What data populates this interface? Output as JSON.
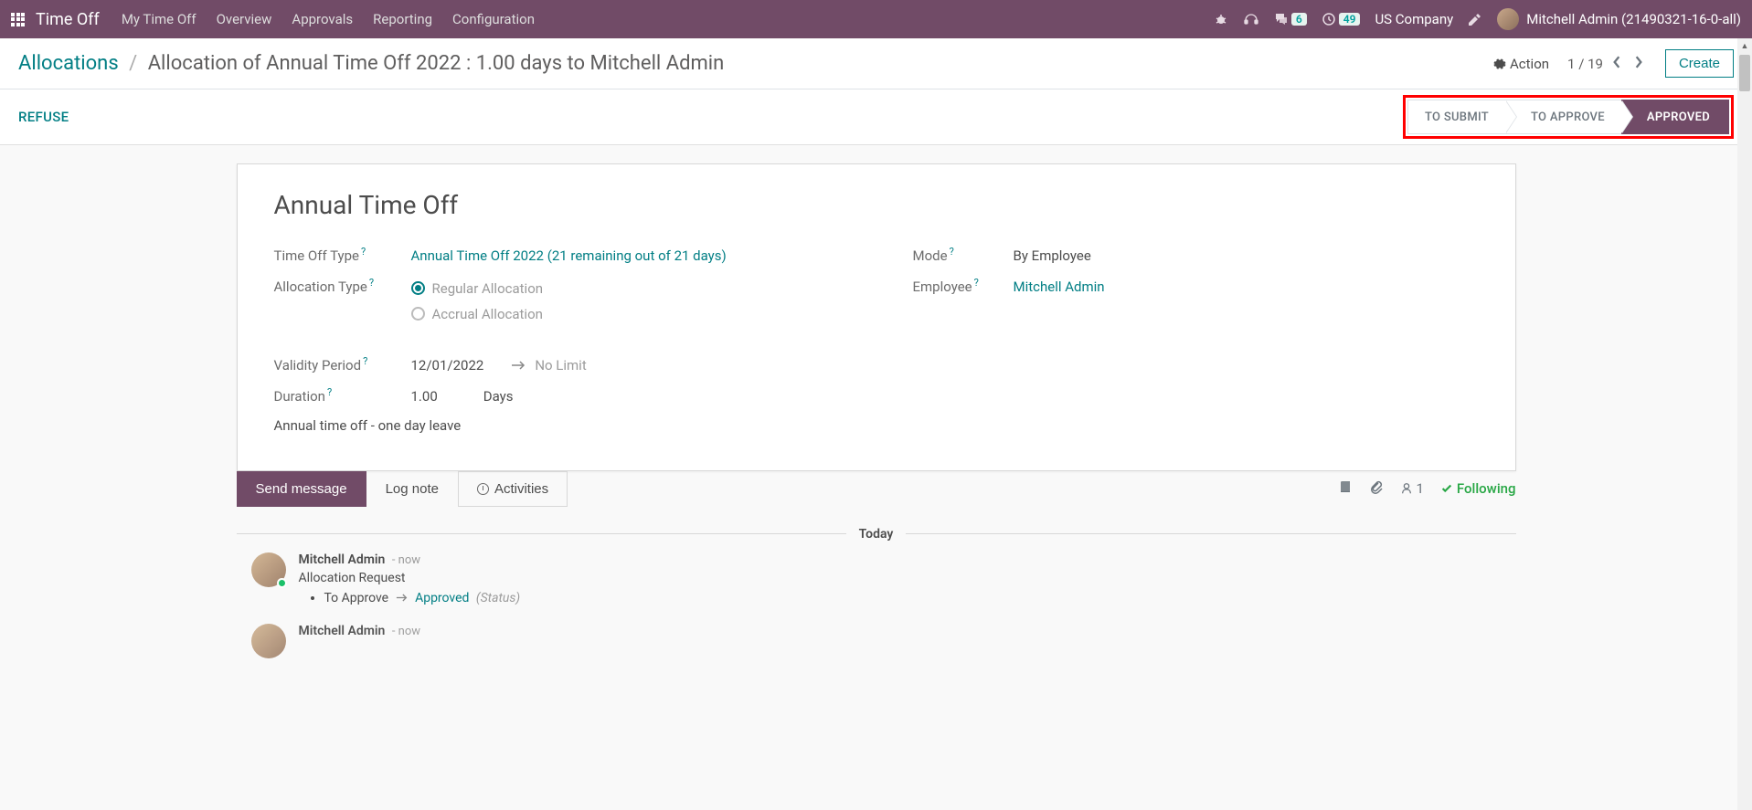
{
  "navbar": {
    "app_title": "Time Off",
    "menu": [
      "My Time Off",
      "Overview",
      "Approvals",
      "Reporting",
      "Configuration"
    ],
    "messaging_badge": "6",
    "activities_badge": "49",
    "company": "US Company",
    "user_name": "Mitchell Admin (21490321-16-0-all)"
  },
  "breadcrumb": {
    "root": "Allocations",
    "current": "Allocation of Annual Time Off 2022 : 1.00 days to Mitchell Admin"
  },
  "cp": {
    "action_label": "Action",
    "pager_value": "1 / 19",
    "create_label": "Create"
  },
  "statusbar": {
    "refuse": "REFUSE",
    "steps": [
      "TO SUBMIT",
      "TO APPROVE",
      "APPROVED"
    ]
  },
  "form": {
    "title": "Annual Time Off",
    "labels": {
      "time_off_type": "Time Off Type",
      "allocation_type": "Allocation Type",
      "validity_period": "Validity Period",
      "duration": "Duration",
      "mode": "Mode",
      "employee": "Employee"
    },
    "values": {
      "time_off_type": "Annual Time Off 2022 (21 remaining out of 21 days)",
      "allocation_type_regular": "Regular Allocation",
      "allocation_type_accrual": "Accrual Allocation",
      "validity_from": "12/01/2022",
      "validity_to": "No Limit",
      "duration_number": "1.00",
      "duration_unit": "Days",
      "mode": "By Employee",
      "employee": "Mitchell Admin",
      "description": "Annual time off - one day leave"
    }
  },
  "chatter": {
    "tabs": {
      "send": "Send message",
      "log": "Log note",
      "activities": "Activities"
    },
    "followers_count": "1",
    "following_label": "Following",
    "divider": "Today",
    "messages": [
      {
        "author": "Mitchell Admin",
        "time": "- now",
        "subject": "Allocation Request",
        "track_old": "To Approve",
        "track_new": "Approved",
        "track_field": "(Status)"
      },
      {
        "author": "Mitchell Admin",
        "time": "- now"
      }
    ]
  }
}
